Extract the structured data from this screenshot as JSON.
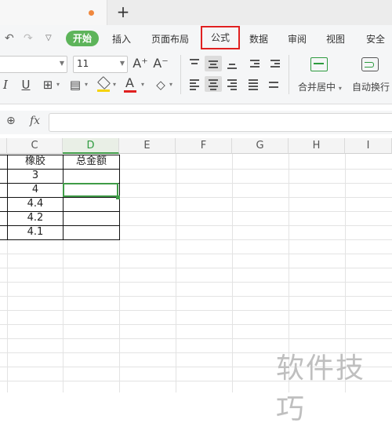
{
  "tabstrip": {
    "new_tab_label": "+"
  },
  "quick_access": {
    "undo_icon": "undo-icon",
    "redo_icon": "redo-icon",
    "more_icon": "dropdown-icon"
  },
  "menu": {
    "home": "开始",
    "insert": "插入",
    "page_layout": "页面布局",
    "formula": "公式",
    "data": "数据",
    "review": "审阅",
    "view": "视图",
    "security": "安全"
  },
  "font": {
    "name": "",
    "size": "11"
  },
  "toolbar": {
    "increase_font": "A⁺",
    "decrease_font": "A⁻",
    "italic": "I",
    "underline": "U",
    "font_color_letter": "A",
    "merge_center": "合并居中",
    "wrap_text": "自动换行"
  },
  "formula_bar": {
    "fx": "fx",
    "value": ""
  },
  "columns": [
    "C",
    "D",
    "E",
    "F",
    "G",
    "H",
    "I"
  ],
  "selected_column": "D",
  "table": {
    "header_c": "橡胶",
    "header_d": "总金额",
    "c_values": [
      "3",
      "4",
      "4.4",
      "4.2",
      "4.1"
    ]
  },
  "watermark": "软件技巧",
  "colors": {
    "accent": "#5db45a",
    "selection": "#3f9b47",
    "highlight_box": "#e02020"
  }
}
